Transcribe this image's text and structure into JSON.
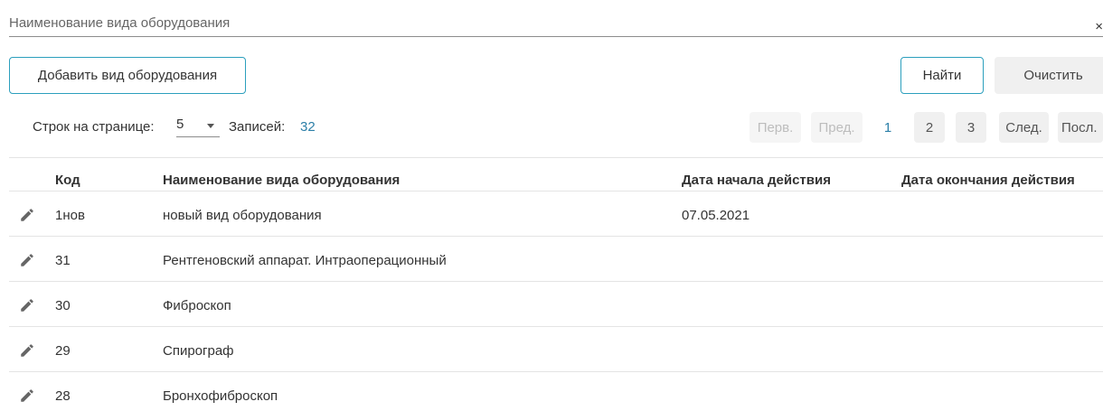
{
  "search": {
    "placeholder": "Наименование вида оборудования",
    "clear_glyph": "×"
  },
  "toolbar": {
    "add_label": "Добавить вид оборудования",
    "find_label": "Найти",
    "clear_label": "Очистить"
  },
  "pager": {
    "rows_label": "Строк на странице:",
    "rows_value": "5",
    "records_label": "Записей:",
    "records_count": "32",
    "first_label": "Перв.",
    "prev_label": "Пред.",
    "pages": [
      "1",
      "2",
      "3"
    ],
    "current_page": "1",
    "next_label": "След.",
    "last_label": "Посл."
  },
  "table": {
    "columns": {
      "code": "Код",
      "name": "Наименование вида оборудования",
      "start": "Дата начала действия",
      "end": "Дата окончания действия"
    },
    "rows": [
      {
        "code": "1нов",
        "name": "новый вид оборудования",
        "start": "07.05.2021",
        "end": ""
      },
      {
        "code": "31",
        "name": "Рентгеновский аппарат. Интраоперационный",
        "start": "",
        "end": ""
      },
      {
        "code": "30",
        "name": "Фиброскоп",
        "start": "",
        "end": ""
      },
      {
        "code": "29",
        "name": "Спирограф",
        "start": "",
        "end": ""
      },
      {
        "code": "28",
        "name": "Бронхофиброскоп",
        "start": "",
        "end": ""
      }
    ]
  },
  "icons": {
    "edit": "pencil-icon",
    "select_caret": "caret-down-icon",
    "clear": "close-icon"
  },
  "colors": {
    "accent": "#2c9fbd",
    "link": "#2c7fa8",
    "text": "#333333",
    "disabled": "#bdbdbd"
  }
}
